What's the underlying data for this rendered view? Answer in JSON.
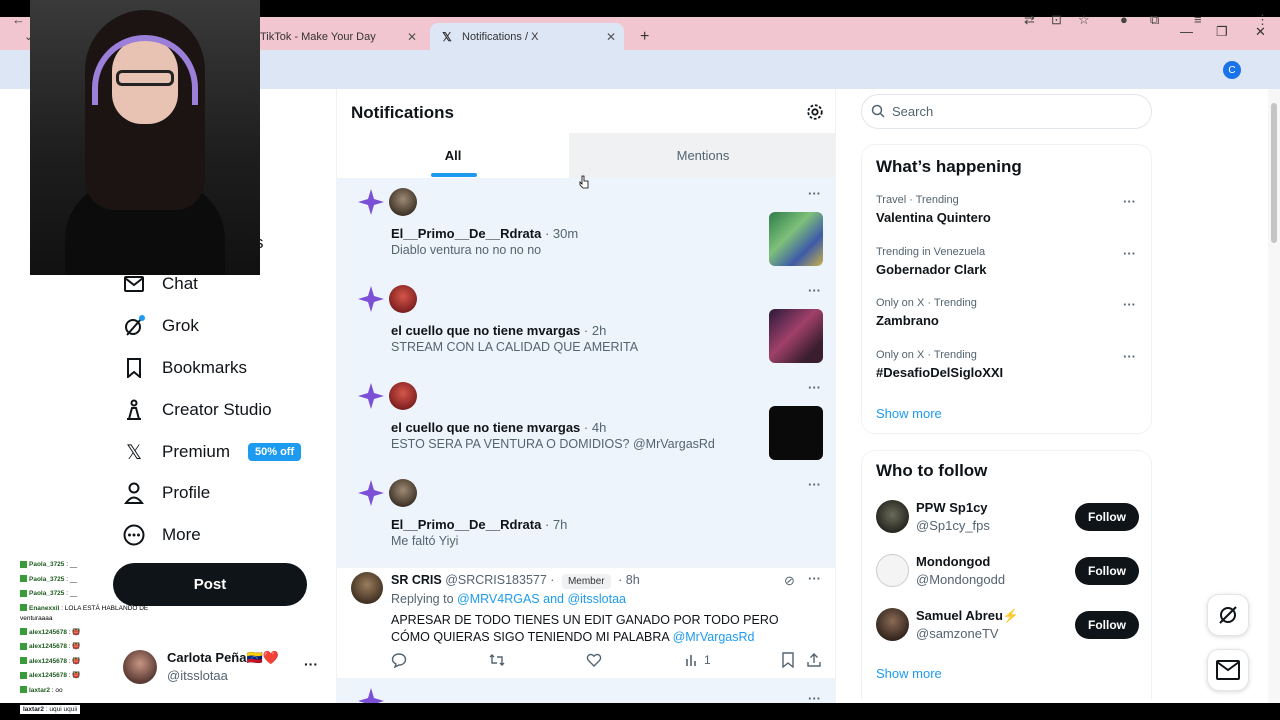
{
  "browser": {
    "tabs": [
      {
        "title": "TikTok - Make Your Day",
        "icon": "tiktok-icon"
      },
      {
        "title": "Notifications / X",
        "icon": "x-logo-icon"
      }
    ],
    "profile_initial": "C"
  },
  "nav": {
    "partial_label": "s",
    "items": [
      {
        "label": "Chat",
        "icon": "mail-icon"
      },
      {
        "label": "Grok",
        "icon": "grok-icon"
      },
      {
        "label": "Bookmarks",
        "icon": "bookmark-icon"
      },
      {
        "label": "Creator Studio",
        "icon": "creator-studio-icon"
      },
      {
        "label": "Premium",
        "icon": "x-logo-icon",
        "badge": "50% off"
      },
      {
        "label": "Profile",
        "icon": "person-icon"
      },
      {
        "label": "More",
        "icon": "more-circle-icon"
      }
    ],
    "post_label": "Post",
    "account": {
      "name": "Carlota Peña🇻🇪❤️",
      "handle": "@itsslotaa",
      "more": "···"
    }
  },
  "chat_overlay": {
    "lines": [
      {
        "user": "Paola_3725",
        "msg": ": __"
      },
      {
        "user": "Paola_3725",
        "msg": ": __"
      },
      {
        "user": "Paola_3725",
        "msg": ": __"
      },
      {
        "user": "Enanexxil",
        "msg": ": LOLA ESTÁ HABLANDO DE venturaaaa"
      },
      {
        "user": "alex1245678",
        "msg": ": 👹"
      },
      {
        "user": "alex1245678",
        "msg": ": 👹"
      },
      {
        "user": "alex1245678",
        "msg": ": 👹"
      },
      {
        "user": "alex1245678",
        "msg": ": 👹"
      },
      {
        "user": "laxtar2",
        "msg": ": oo"
      }
    ],
    "last": {
      "user": "laxtar2",
      "msg": ": uqui uquii"
    }
  },
  "notifications": {
    "title": "Notifications",
    "tabs": {
      "all": "All",
      "mentions": "Mentions"
    },
    "items": [
      {
        "name": "El__Primo__De__Rdrata",
        "time": "· 30m",
        "text": "Diablo ventura no no no no"
      },
      {
        "name": "el cuello que no tiene mvargas",
        "time": "· 2h",
        "text": "STREAM CON LA CALIDAD QUE AMERITA"
      },
      {
        "name": "el cuello que no tiene mvargas",
        "time": "· 4h",
        "text": "ESTO SERA PA VENTURA O DOMIDIOS? @MrVargasRd"
      },
      {
        "name": "El__Primo__De__Rdrata",
        "time": "· 7h",
        "text": "Me faltó Yiyi"
      }
    ],
    "reply": {
      "name": "SR CRIS",
      "handle": "@SRCRIS183577 ·",
      "member": "Member",
      "time": "· 8h",
      "replying_prefix": "Replying to",
      "replying_to": "@MRV4RGAS and @itsslotaa",
      "text": "APRESAR DE TODO TIENES UN EDIT GANADO POR TODO PERO CÓMO QUIERAS SIGO TENIENDO MI PALABRA",
      "mention": "@MrVargasRd",
      "views": "1"
    }
  },
  "sidebar": {
    "search_placeholder": "Search",
    "whats_happening": "What’s happening",
    "trends": [
      {
        "meta": "Travel · Trending",
        "name": "Valentina Quintero"
      },
      {
        "meta": "Trending in Venezuela",
        "name": "Gobernador Clark"
      },
      {
        "meta": "Only on X · Trending",
        "name": "Zambrano"
      },
      {
        "meta": "Only on X · Trending",
        "name": "#DesafioDelSigloXXI"
      }
    ],
    "show_more": "Show more",
    "who_to_follow": "Who to follow",
    "follow_suggestions": [
      {
        "name": "PPW Sp1cy",
        "handle": "@Sp1cy_fps",
        "button": "Follow"
      },
      {
        "name": "Mondongod",
        "handle": "@Mondongodd",
        "button": "Follow"
      },
      {
        "name": "Samuel Abreu⚡",
        "handle": "@samzoneTV",
        "button": "Follow"
      }
    ],
    "show_more_2": "Show more"
  },
  "colors": {
    "accent": "#1d9bf0",
    "grok_purple": "#7b4fd6",
    "feed_bg": "#eef4fb"
  }
}
